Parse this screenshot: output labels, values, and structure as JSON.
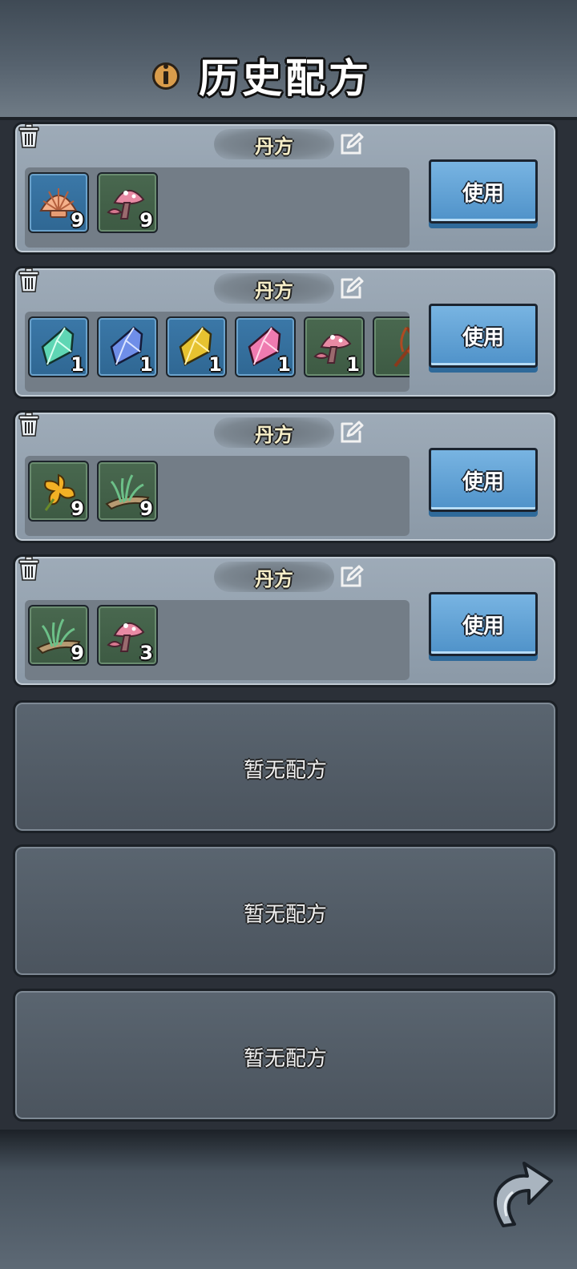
{
  "header": {
    "title": "历史配方",
    "info_icon": "info-icon"
  },
  "recipes": [
    {
      "name": "丹方",
      "use_label": "使用",
      "ingredients": [
        {
          "icon": "shell-icon",
          "count": "9",
          "bg": "blue"
        },
        {
          "icon": "mushroom-icon",
          "count": "9",
          "bg": "green"
        }
      ]
    },
    {
      "name": "丹方",
      "use_label": "使用",
      "ingredients": [
        {
          "icon": "green-crystal-icon",
          "count": "1",
          "bg": "blue"
        },
        {
          "icon": "blue-crystal-icon",
          "count": "1",
          "bg": "blue"
        },
        {
          "icon": "yellow-crystal-icon",
          "count": "1",
          "bg": "blue"
        },
        {
          "icon": "pink-crystal-icon",
          "count": "1",
          "bg": "blue"
        },
        {
          "icon": "mushroom-icon",
          "count": "1",
          "bg": "green"
        },
        {
          "icon": "root-icon",
          "count": "",
          "bg": "green"
        }
      ]
    },
    {
      "name": "丹方",
      "use_label": "使用",
      "ingredients": [
        {
          "icon": "flower-icon",
          "count": "9",
          "bg": "green"
        },
        {
          "icon": "grass-icon",
          "count": "9",
          "bg": "green"
        }
      ]
    },
    {
      "name": "丹方",
      "use_label": "使用",
      "ingredients": [
        {
          "icon": "grass-icon",
          "count": "9",
          "bg": "green"
        },
        {
          "icon": "mushroom-icon",
          "count": "3",
          "bg": "green"
        }
      ]
    }
  ],
  "empty_slots": [
    "暂无配方",
    "暂无配方",
    "暂无配方"
  ],
  "colors": {
    "use_button": "#5a9ed4",
    "card": "#95a3b1",
    "empty_card": "#535d68"
  }
}
